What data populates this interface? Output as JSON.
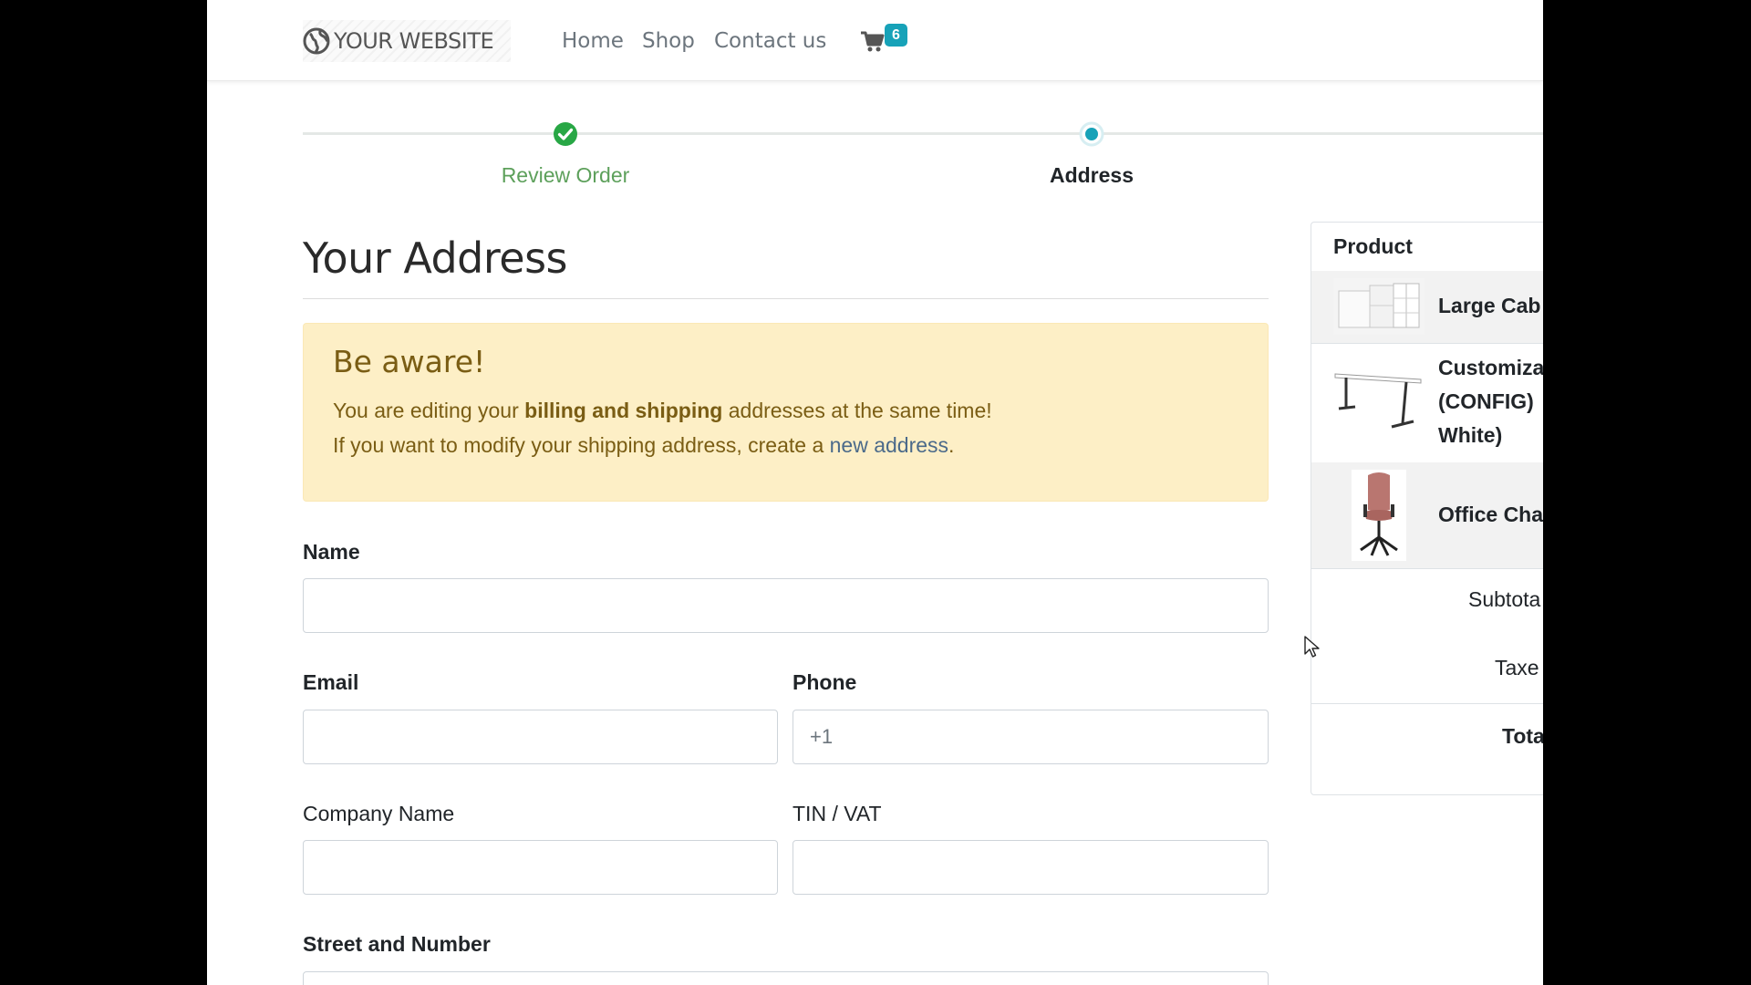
{
  "header": {
    "logo_text": "YOUR WEBSITE",
    "nav": [
      {
        "label": "Home"
      },
      {
        "label": "Shop"
      },
      {
        "label": "Contact us"
      }
    ],
    "cart_count": "6"
  },
  "steps": [
    {
      "label": "Review Order",
      "status": "done"
    },
    {
      "label": "Address",
      "status": "current"
    }
  ],
  "main": {
    "title": "Your Address",
    "alert": {
      "heading": "Be aware!",
      "line1_pre": "You are editing your ",
      "line1_bold": "billing and shipping",
      "line1_post": " addresses at the same time!",
      "line2_pre": "If you want to modify your shipping address, create a ",
      "line2_link": "new address",
      "line2_post": "."
    },
    "form": {
      "name_label": "Name",
      "email_label": "Email",
      "phone_label": "Phone",
      "phone_placeholder": "+1",
      "company_label": "Company Name",
      "vat_label": "TIN / VAT",
      "street_label": "Street and Number"
    }
  },
  "summary": {
    "header": "Product",
    "products": [
      {
        "name_lines": [
          "Large Cab"
        ]
      },
      {
        "name_lines": [
          "Customiza",
          "(CONFIG)",
          "White)"
        ]
      },
      {
        "name_lines": [
          "Office Cha"
        ]
      }
    ],
    "subtotal_label": "Subtota",
    "taxes_label": "Taxe",
    "total_label": "Tota"
  },
  "colors": {
    "accent": "#17a2b8",
    "success": "#28a745",
    "alert_bg": "#fdefc6",
    "alert_text": "#7a5d14"
  },
  "icons": [
    "globe-icon",
    "cart-icon",
    "check-circle-icon",
    "radio-current-icon",
    "mouse-cursor-icon"
  ]
}
